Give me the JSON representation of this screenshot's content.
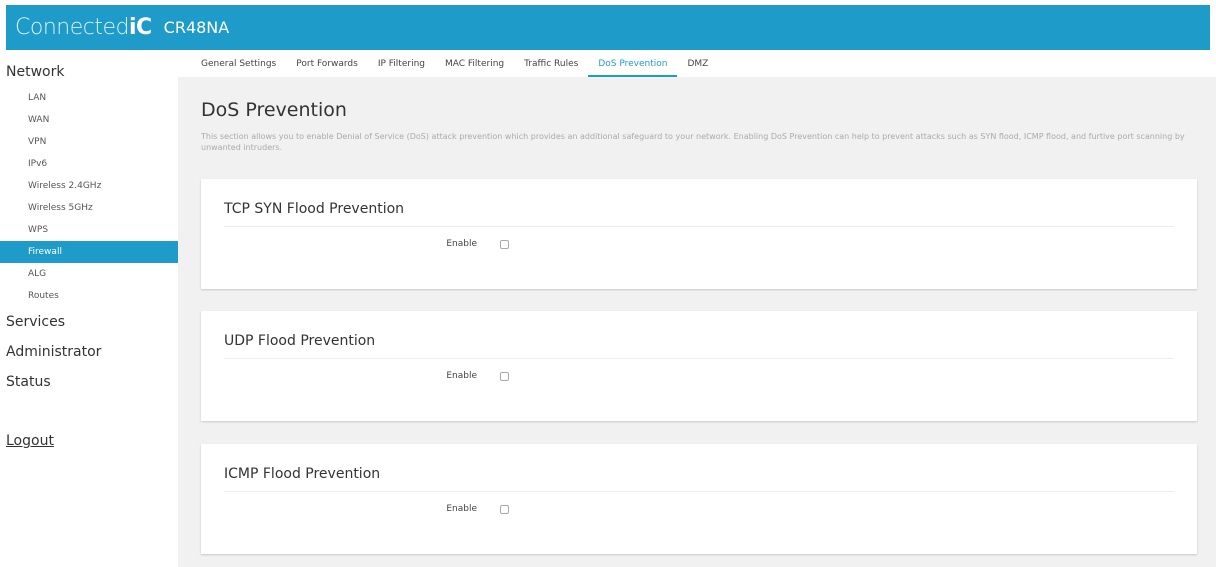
{
  "header": {
    "brand_light": "Connected",
    "brand_bold": "iC",
    "model": "CR48NA"
  },
  "sidebar": {
    "network_label": "Network",
    "network_items": [
      {
        "label": "LAN"
      },
      {
        "label": "WAN"
      },
      {
        "label": "VPN"
      },
      {
        "label": "IPv6"
      },
      {
        "label": "Wireless 2.4GHz"
      },
      {
        "label": "Wireless 5GHz"
      },
      {
        "label": "WPS"
      },
      {
        "label": "Firewall",
        "active": true
      },
      {
        "label": "ALG"
      },
      {
        "label": "Routes"
      }
    ],
    "services_label": "Services",
    "administrator_label": "Administrator",
    "status_label": "Status",
    "logout_label": "Logout"
  },
  "tabs": [
    {
      "label": "General Settings"
    },
    {
      "label": "Port Forwards"
    },
    {
      "label": "IP Filtering"
    },
    {
      "label": "MAC Filtering"
    },
    {
      "label": "Traffic Rules"
    },
    {
      "label": "DoS Prevention",
      "active": true
    },
    {
      "label": "DMZ"
    }
  ],
  "main": {
    "title": "DoS Prevention",
    "description": "This section allows you to enable Denial of Service (DoS) attack prevention which provides an additional safeguard to your network. Enabling DoS Prevention can help to prevent attacks such as SYN flood, ICMP flood, and furtive port scanning by unwanted intruders.",
    "panels": [
      {
        "title": "TCP SYN Flood Prevention",
        "enable_label": "Enable",
        "checked": false
      },
      {
        "title": "UDP Flood Prevention",
        "enable_label": "Enable",
        "checked": false
      },
      {
        "title": "ICMP Flood Prevention",
        "enable_label": "Enable",
        "checked": false
      }
    ]
  },
  "colors": {
    "accent": "#1f9bc9",
    "content_bg": "#f1f1f1"
  }
}
